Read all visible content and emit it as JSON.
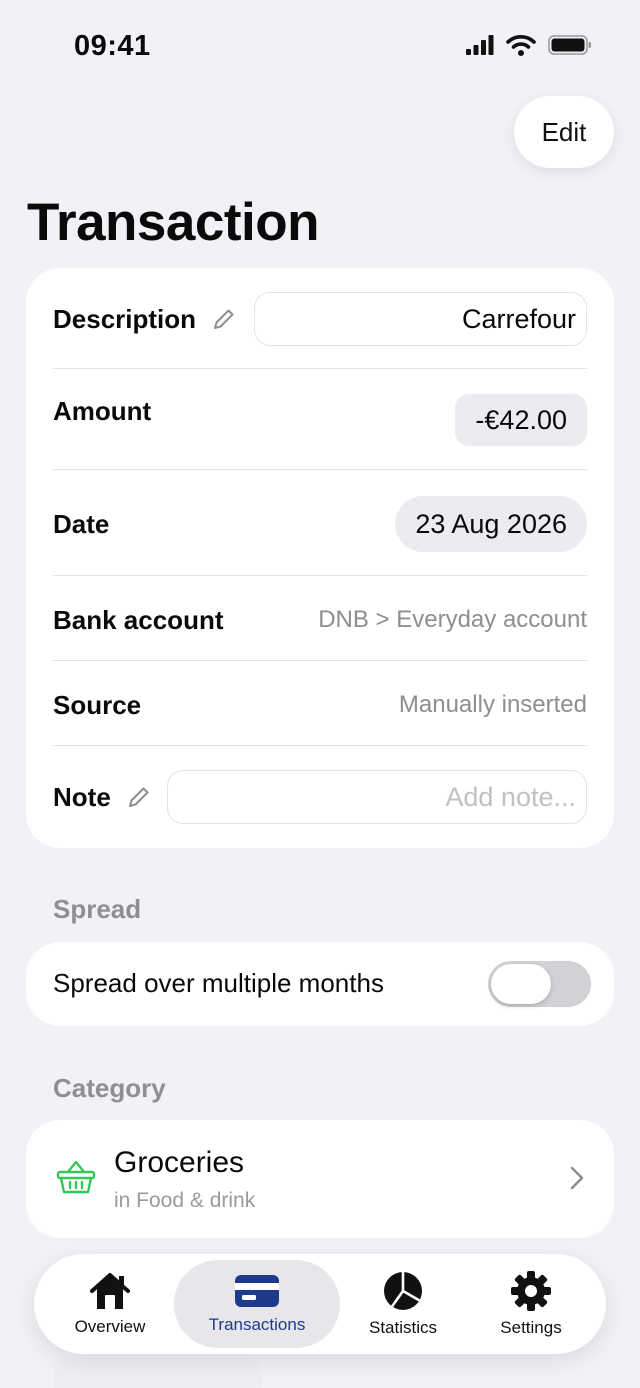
{
  "status_bar": {
    "time": "09:41"
  },
  "header": {
    "edit_label": "Edit",
    "title": "Transaction"
  },
  "details": {
    "description": {
      "label": "Description",
      "value": "Carrefour"
    },
    "amount": {
      "label": "Amount",
      "value": "-€42.00"
    },
    "date": {
      "label": "Date",
      "value": "23 Aug 2026"
    },
    "bank_account": {
      "label": "Bank account",
      "value": "DNB > Everyday account"
    },
    "source": {
      "label": "Source",
      "value": "Manually inserted"
    },
    "note": {
      "label": "Note",
      "placeholder": "Add note..."
    }
  },
  "spread": {
    "section_title": "Spread",
    "label": "Spread over multiple months",
    "enabled": false
  },
  "category": {
    "section_title": "Category",
    "name": "Groceries",
    "parent": "in Food & drink",
    "icon": "basket-icon",
    "icon_color": "#34c759"
  },
  "tab_bar": {
    "active": "Transactions",
    "active_color": "#1e3a8a",
    "tabs": [
      {
        "label": "Overview",
        "icon": "house-icon"
      },
      {
        "label": "Transactions",
        "icon": "card-icon"
      },
      {
        "label": "Statistics",
        "icon": "pie-chart-icon"
      },
      {
        "label": "Settings",
        "icon": "gear-icon"
      }
    ]
  }
}
